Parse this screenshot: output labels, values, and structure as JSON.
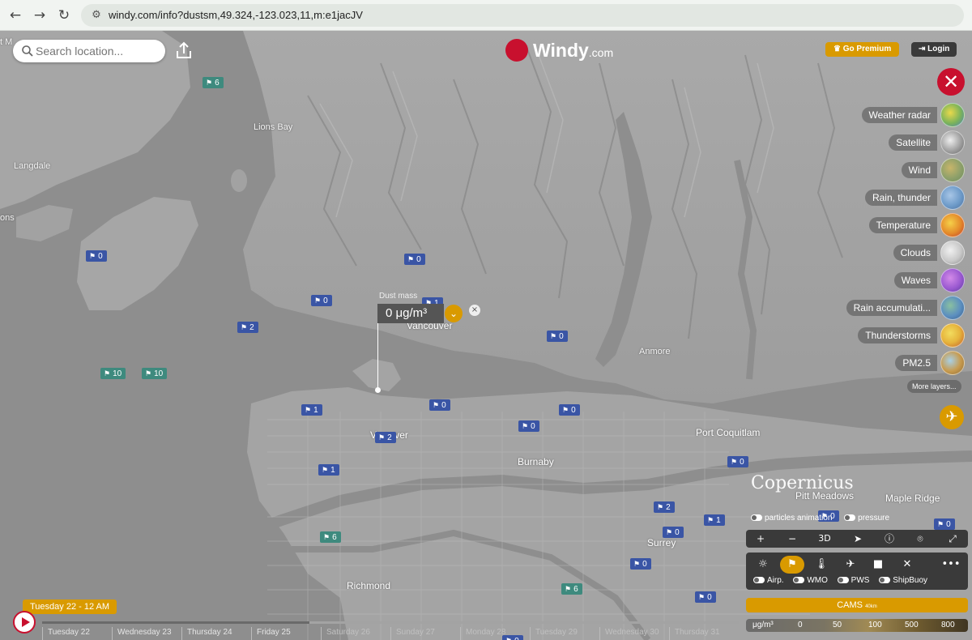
{
  "browser": {
    "back_icon": "←",
    "forward_icon": "→",
    "reload_icon": "↻",
    "site_info_icon": "⚙",
    "url": "windy.com/info?dustsm,49.324,-123.023,11,m:e1jacJV"
  },
  "search": {
    "placeholder": "Search location..."
  },
  "logo": {
    "name": "Windy",
    "suffix": ".com"
  },
  "header": {
    "premium_label": "Go Premium",
    "login_label": "Login"
  },
  "close_label": "✕",
  "layers": [
    {
      "label": "Weather radar",
      "color": "#7bb35a"
    },
    {
      "label": "Satellite",
      "color": "#b7b7b7"
    },
    {
      "label": "Wind",
      "color": "#8ea06a"
    },
    {
      "label": "Rain, thunder",
      "color": "#6e9bc9"
    },
    {
      "label": "Temperature",
      "color": "#e48a2a"
    },
    {
      "label": "Clouds",
      "color": "#c9c9c9"
    },
    {
      "label": "Waves",
      "color": "#9b5ad1"
    },
    {
      "label": "Rain accumulati...",
      "color": "#5c8fc0"
    },
    {
      "label": "Thunderstorms",
      "color": "#e6b43c"
    },
    {
      "label": "PM2.5",
      "color": "#c79a4d"
    }
  ],
  "more_layers": "More layers...",
  "picker": {
    "title": "Dust mass",
    "value": "0 μg/m³"
  },
  "places": [
    {
      "name": "Lions Bay"
    },
    {
      "name": "Langdale"
    },
    {
      "name": "Vancouver"
    },
    {
      "name": "Anmore"
    },
    {
      "name": "Port Coquitlam"
    },
    {
      "name": "Burnaby"
    },
    {
      "name": "Pitt Meadows"
    },
    {
      "name": "Maple Ridge"
    },
    {
      "name": "Surrey"
    },
    {
      "name": "Richmond"
    },
    {
      "name": "V...ouver"
    },
    {
      "name": "ons"
    },
    {
      "name": "t M"
    }
  ],
  "stations": [
    {
      "value": "6"
    },
    {
      "value": "0"
    },
    {
      "value": "0"
    },
    {
      "value": "0"
    },
    {
      "value": "2"
    },
    {
      "value": "10"
    },
    {
      "value": "10"
    },
    {
      "value": "0"
    },
    {
      "value": "1"
    },
    {
      "value": "0"
    },
    {
      "value": "0"
    },
    {
      "value": "0"
    },
    {
      "value": "2"
    },
    {
      "value": "1"
    },
    {
      "value": "0"
    },
    {
      "value": "6"
    },
    {
      "value": "2"
    },
    {
      "value": "1"
    },
    {
      "value": "0"
    },
    {
      "value": "0"
    },
    {
      "value": "6"
    },
    {
      "value": "0"
    },
    {
      "value": "0"
    },
    {
      "value": "0"
    },
    {
      "value": "0"
    },
    {
      "value": "1"
    }
  ],
  "copernicus": "Copernicus",
  "map_toggles": {
    "particles": "particles animation",
    "pressure": "pressure"
  },
  "map_controls": {
    "zoom_in": "+",
    "zoom_out": "−",
    "three_d": "3D"
  },
  "overlay_toggles": {
    "airp": "Airp.",
    "wmo": "WMO",
    "pws": "PWS",
    "shipbuoy": "ShipBuoy"
  },
  "model": {
    "name": "CAMS",
    "resolution": "40km"
  },
  "legend": {
    "unit": "μg/m³",
    "ticks": [
      "0",
      "50",
      "100",
      "500",
      "800"
    ]
  },
  "timeline": {
    "current": "Tuesday 22 - 12 AM",
    "days": [
      "Tuesday 22",
      "Wednesday 23",
      "Thursday 24",
      "Friday 25",
      "Saturday 26",
      "Sunday 27",
      "Monday 28",
      "Tuesday 29",
      "Wednesday 30",
      "Thursday 31"
    ]
  }
}
